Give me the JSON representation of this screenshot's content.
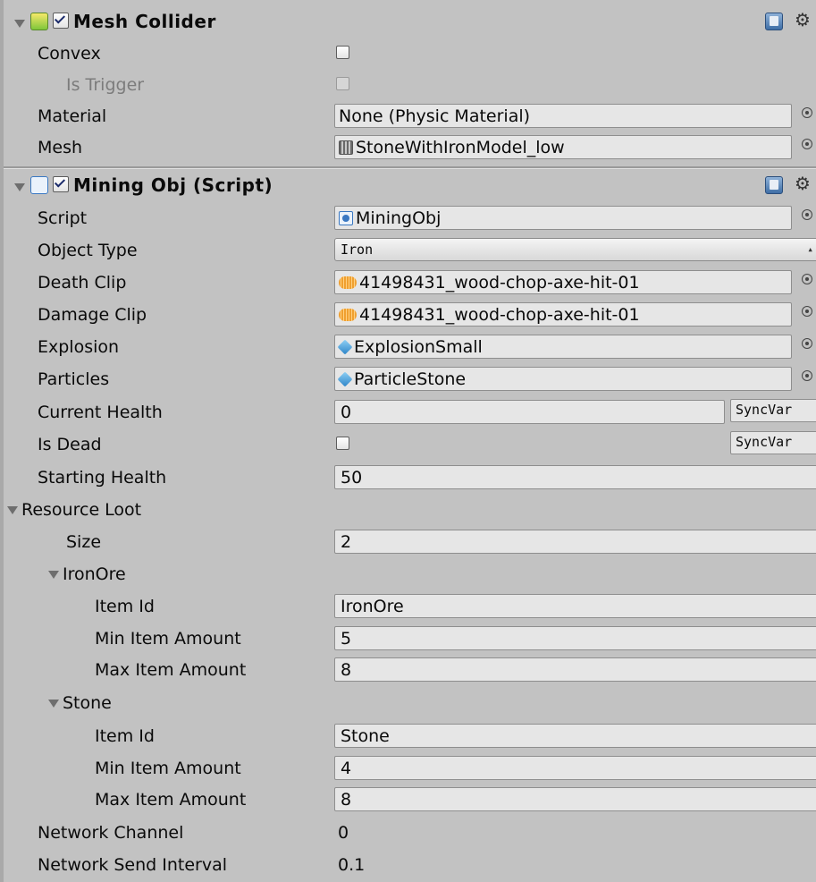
{
  "mesh_collider": {
    "title": "Mesh Collider",
    "enabled": true,
    "convex_label": "Convex",
    "convex_checked": false,
    "is_trigger_label": "Is Trigger",
    "is_trigger_checked": false,
    "material_label": "Material",
    "material_value": "None (Physic Material)",
    "mesh_label": "Mesh",
    "mesh_value": "StoneWithIronModel_low"
  },
  "mining_obj": {
    "title": "Mining Obj (Script)",
    "enabled": true,
    "script_label": "Script",
    "script_value": "MiningObj",
    "object_type_label": "Object Type",
    "object_type_value": "Iron",
    "death_clip_label": "Death Clip",
    "death_clip_value": "41498431_wood-chop-axe-hit-01",
    "damage_clip_label": "Damage Clip",
    "damage_clip_value": "41498431_wood-chop-axe-hit-01",
    "explosion_label": "Explosion",
    "explosion_value": "ExplosionSmall",
    "particles_label": "Particles",
    "particles_value": "ParticleStone",
    "current_health_label": "Current Health",
    "current_health_value": "0",
    "syncvar_label": "SyncVar",
    "is_dead_label": "Is Dead",
    "is_dead_checked": false,
    "starting_health_label": "Starting Health",
    "starting_health_value": "50",
    "resource_loot": {
      "label": "Resource Loot",
      "size_label": "Size",
      "size_value": "2",
      "items": [
        {
          "name": "IronOre",
          "item_id_label": "Item Id",
          "item_id": "IronOre",
          "min_label": "Min Item Amount",
          "min": "5",
          "max_label": "Max Item Amount",
          "max": "8"
        },
        {
          "name": "Stone",
          "item_id_label": "Item Id",
          "item_id": "Stone",
          "min_label": "Min Item Amount",
          "min": "4",
          "max_label": "Max Item Amount",
          "max": "8"
        }
      ]
    },
    "network_channel_label": "Network Channel",
    "network_channel_value": "0",
    "network_send_interval_label": "Network Send Interval",
    "network_send_interval_value": "0.1"
  },
  "icons": {
    "mesh_collider": "mesh-collider-icon",
    "script_component": "csharp-script-icon",
    "help": "help-book-icon",
    "settings": "gear-icon",
    "object_picker": "object-picker-icon"
  },
  "colors": {
    "panel_bg": "#c2c2c2",
    "field_bg": "#e6e6e6",
    "disabled_text": "#7c7c7c"
  }
}
